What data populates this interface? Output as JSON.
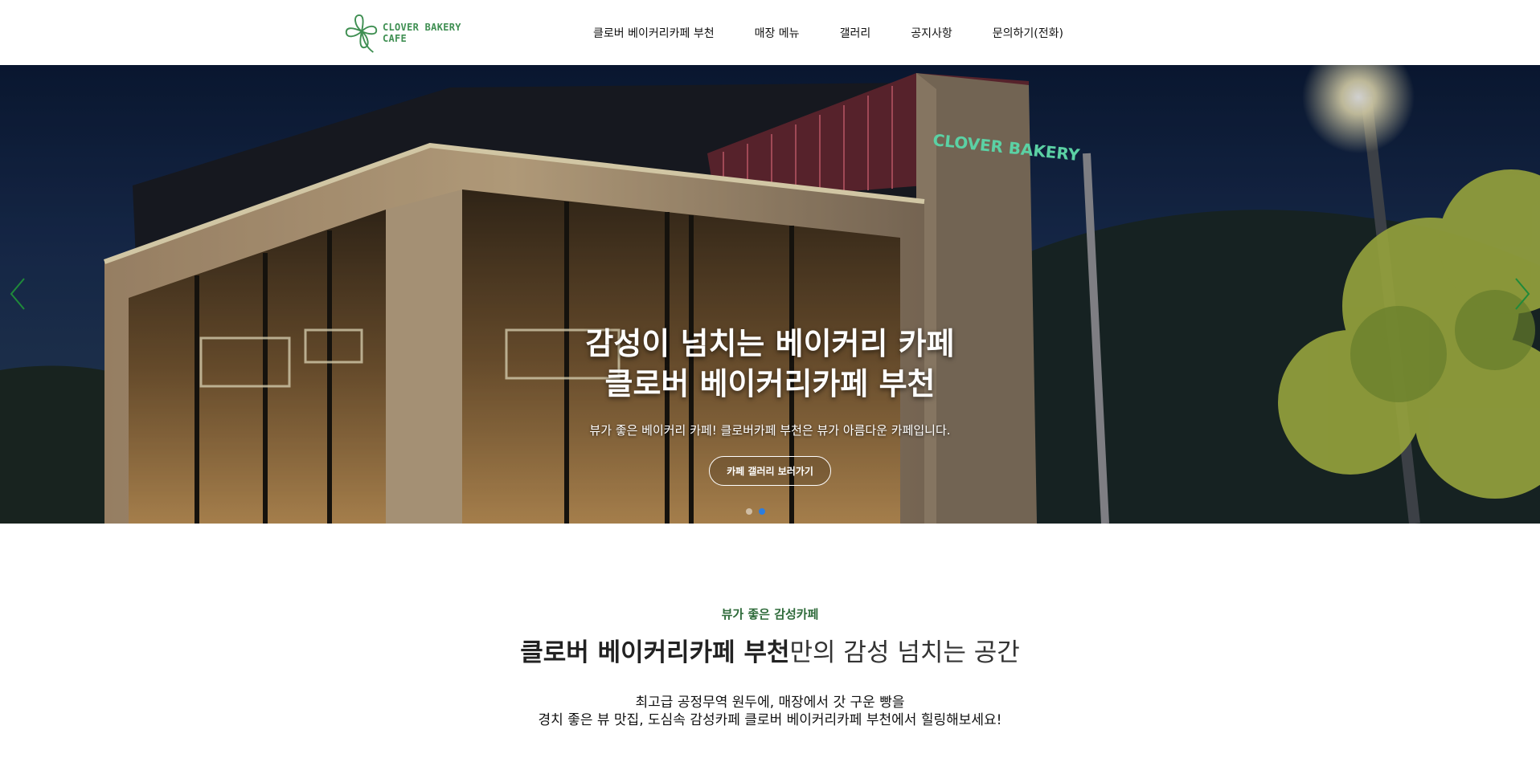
{
  "header": {
    "logo_text": "CLOVER BAKERY CAFE",
    "nav": [
      {
        "label": "클로버 베이커리카페 부천"
      },
      {
        "label": "매장 메뉴"
      },
      {
        "label": "갤러리"
      },
      {
        "label": "공지사항"
      },
      {
        "label": "문의하기(전화)"
      }
    ]
  },
  "hero": {
    "title_line1": "감성이 넘치는 베이커리 카페",
    "title_line2": "클로버 베이커리카페 부천",
    "subtitle": "뷰가 좋은 베이커리 카페! 클로버카페 부천은 뷰가 아름다운 카페입니다.",
    "button_label": "카페 갤러리 보러가기",
    "sign_text": "CLOVER BAKERY",
    "slide_count": 2,
    "active_slide": 2
  },
  "intro": {
    "tag": "뷰가 좋은 감성카페",
    "title_strong": "클로버 베이커리카페 부천",
    "title_light": "만의 감성 넘치는 공간",
    "desc_line1": "최고급 공정무역 원두에, 매장에서 갓 구운 빵을",
    "desc_line2": "경치 좋은 뷰 맛집, 도심속 감성카페 클로버 베이커리카페 부천에서 힐링해보세요!"
  },
  "colors": {
    "brand_green": "#3f8f52",
    "tag_green": "#2f6b3b",
    "arrow_green": "#1f8a3a",
    "active_dot": "#2b7de0"
  }
}
